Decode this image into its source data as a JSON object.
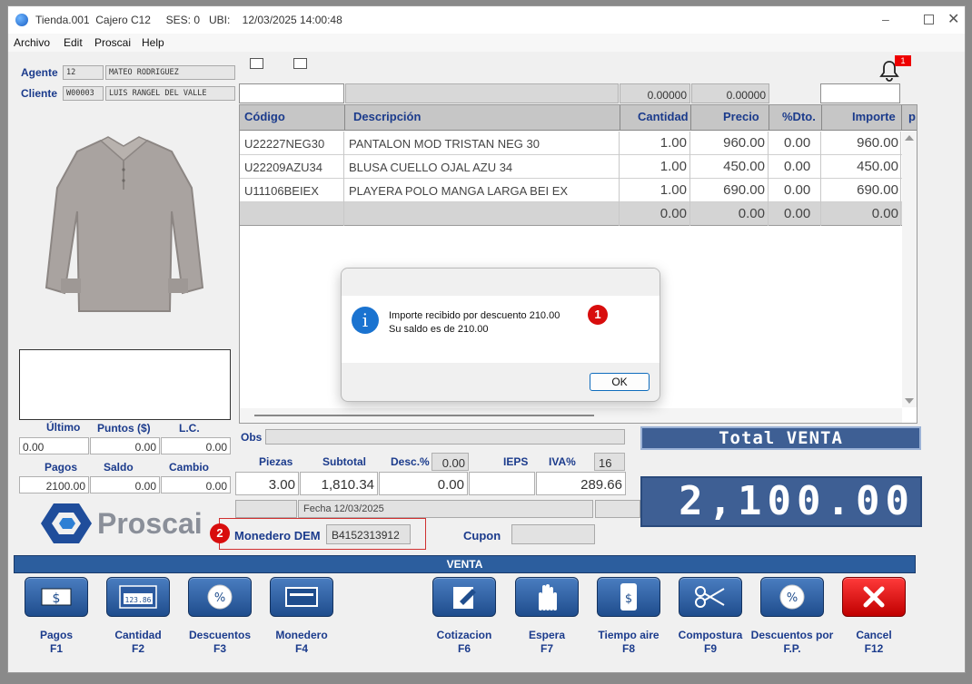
{
  "window": {
    "title": "Tienda.001  Cajero C12     SES: 0   UBI:    12/03/2025 14:00:48"
  },
  "menu": [
    "Archivo",
    "Edit",
    "Proscai",
    "Help"
  ],
  "notification": {
    "count": "1"
  },
  "customer": {
    "agent_label": "Agente",
    "agent_code": "12",
    "agent_name": "MATEO RODRIGUEZ",
    "client_label": "Cliente",
    "client_code": "W00003",
    "client_name": "LUIS RANGEL DEL VALLE"
  },
  "table": {
    "top_values": [
      "0.00000",
      "0.00000"
    ],
    "headers": [
      "Código",
      "Descripción",
      "Cantidad",
      "Precio",
      "%Dto.",
      "Importe",
      "p"
    ],
    "rows": [
      {
        "code": "U22227NEG30",
        "desc": "PANTALON MOD TRISTAN NEG 30",
        "qty": "1.00",
        "price": "960.00",
        "dto": "0.00",
        "amount": "960.00"
      },
      {
        "code": "U22209AZU34",
        "desc": "BLUSA CUELLO OJAL AZU 34",
        "qty": "1.00",
        "price": "450.00",
        "dto": "0.00",
        "amount": "450.00"
      },
      {
        "code": "U11106BEIEX",
        "desc": "PLAYERA POLO MANGA LARGA BEI EX",
        "qty": "1.00",
        "price": "690.00",
        "dto": "0.00",
        "amount": "690.00"
      },
      {
        "code": "",
        "desc": "",
        "qty": "0.00",
        "price": "0.00",
        "dto": "0.00",
        "amount": "0.00"
      }
    ]
  },
  "dialog": {
    "line1": "Importe recibido por descuento 210.00",
    "line2": "Su saldo es de 210.00",
    "ok": "OK"
  },
  "markers": {
    "one": "1",
    "two": "2"
  },
  "points": {
    "ultimo_label": "Último",
    "puntos_label": "Puntos ($)",
    "lc_label": "L.C.",
    "ultimo": "0.00",
    "puntos": "0.00",
    "lc": "0.00",
    "pagos_label": "Pagos",
    "saldo_label": "Saldo",
    "cambio_label": "Cambio",
    "pagos": "2100.00",
    "saldo": "0.00",
    "cambio": "0.00"
  },
  "logo": {
    "text": "Proscai"
  },
  "summary": {
    "obs_label": "Obs",
    "piezas_label": "Piezas",
    "subtotal_label": "Subtotal",
    "desc_label": "Desc.%",
    "desc_pct": "0.00",
    "ieps_label": "IEPS",
    "iva_label": "IVA%",
    "iva_pct": "16",
    "piezas": "3.00",
    "subtotal": "1,810.34",
    "desc": "0.00",
    "iva": "289.66",
    "fecha": "Fecha 12/03/2025",
    "monedero_label": "Monedero DEM",
    "monedero": "B4152313912",
    "cupon_label": "Cupon"
  },
  "total": {
    "label": "Total VENTA",
    "value": "2,100.00"
  },
  "bar": {
    "label": "VENTA"
  },
  "fkeys": [
    {
      "name": "Pagos",
      "key": "F1",
      "icon": "cash-icon"
    },
    {
      "name": "Cantidad",
      "key": "F2",
      "icon": "calculator-icon"
    },
    {
      "name": "Descuentos",
      "key": "F3",
      "icon": "percent-icon"
    },
    {
      "name": "Monedero",
      "key": "F4",
      "icon": "card-icon"
    },
    {
      "name": "Cotizacion",
      "key": "F6",
      "icon": "edit-icon"
    },
    {
      "name": "Espera",
      "key": "F7",
      "icon": "hand-icon"
    },
    {
      "name": "Tiempo aire",
      "key": "F8",
      "icon": "phone-icon"
    },
    {
      "name": "Compostura",
      "key": "F9",
      "icon": "scissors-icon"
    },
    {
      "name": "Descuentos por",
      "key": "F.P.",
      "icon": "percent-icon"
    },
    {
      "name": "Cancel",
      "key": "F12",
      "icon": "x-icon"
    }
  ],
  "colors": {
    "accent": "#1b3b8c",
    "total_bg": "#3e5f94",
    "bar_bg": "#2c5e9e",
    "cancel": "#e01818"
  }
}
